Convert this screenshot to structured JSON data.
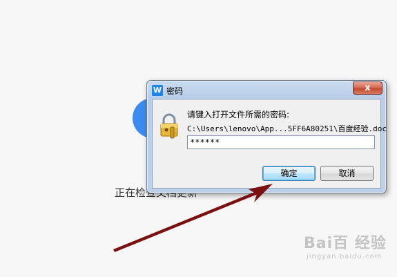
{
  "background": {
    "status_text": "正在检查文档更新",
    "accent_color": "#3c8cf0"
  },
  "dialog": {
    "title": "密码",
    "app_icon_letter": "W",
    "close_symbol": "x",
    "prompt": "请键入打开文件所需的密码:",
    "file_path": "C:\\Users\\lenovo\\App...5FF6A80251\\百度经验.doc",
    "password_value": "******",
    "ok_label": "确定",
    "cancel_label": "取消",
    "icons": {
      "app": "wps-writer-icon",
      "lock": "padlock-key-icon",
      "close": "close-icon"
    }
  },
  "annotation": {
    "arrow_color": "#7a1010"
  },
  "watermark": {
    "main": "Bai百 经验",
    "sub": "jingyan.baidu.com"
  }
}
